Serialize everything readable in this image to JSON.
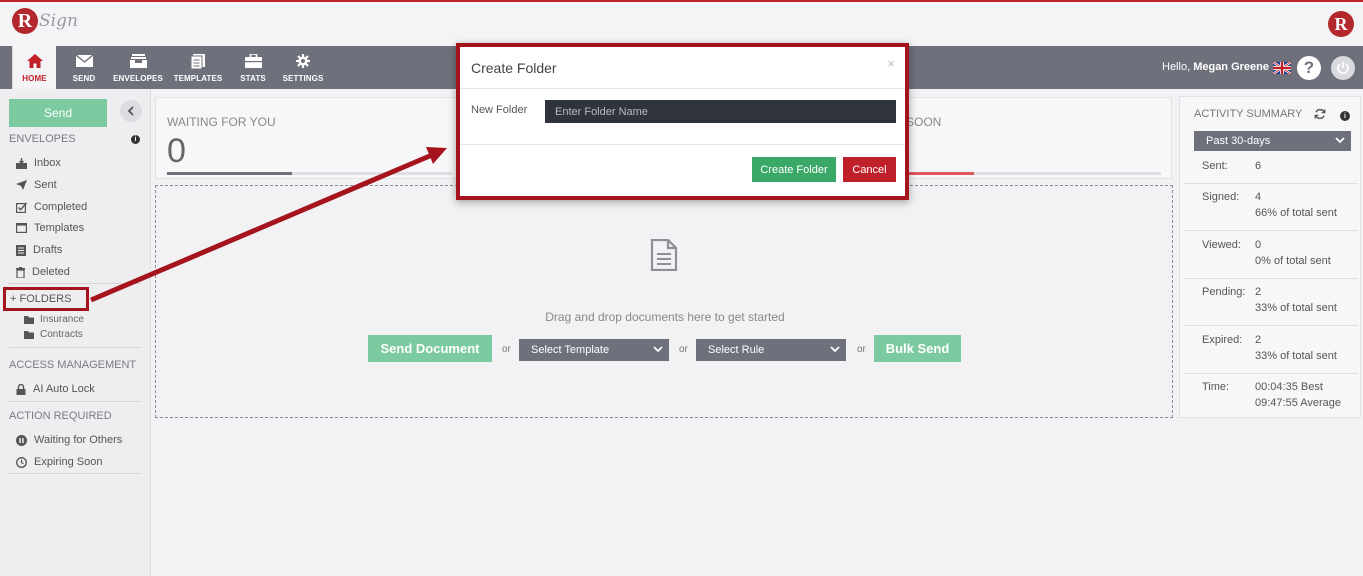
{
  "brand": {
    "logo_text": "Sign",
    "badge_letter": "R"
  },
  "nav": {
    "items": [
      {
        "label": "HOME",
        "icon": "home-icon"
      },
      {
        "label": "SEND",
        "icon": "envelope-icon"
      },
      {
        "label": "ENVELOPES",
        "icon": "inbox-tray-icon"
      },
      {
        "label": "TEMPLATES",
        "icon": "template-icon"
      },
      {
        "label": "STATS",
        "icon": "briefcase-icon"
      },
      {
        "label": "SETTINGS",
        "icon": "gear-icon"
      }
    ],
    "greeting_prefix": "Hello,",
    "user_name": "Megan Greene",
    "help_glyph": "?"
  },
  "sidebar": {
    "send_label": "Send",
    "envelopes_title": "ENVELOPES",
    "info_glyph": "i",
    "envelope_items": [
      "Inbox",
      "Sent",
      "Completed",
      "Templates",
      "Drafts",
      "Deleted"
    ],
    "folders_title": "+ FOLDERS",
    "folders": [
      "Insurance",
      "Contracts"
    ],
    "access_title": "ACCESS MANAGEMENT",
    "access_items": [
      "AI Auto Lock"
    ],
    "action_title": "ACTION REQUIRED",
    "action_items": [
      "Waiting for Others",
      "Expiring Soon"
    ]
  },
  "summary": {
    "waiting_label": "WAITING FOR YOU",
    "waiting_value": "0",
    "expiring_label_partial": "SOON",
    "accent_gray": "#6e717c",
    "accent_red": "#e0575d"
  },
  "dropzone": {
    "drag_text": "Drag and drop documents here to get started",
    "send_document": "Send Document",
    "or": "or",
    "select_template": "Select Template",
    "select_rule": "Select Rule",
    "bulk_send": "Bulk Send"
  },
  "activity": {
    "title": "ACTIVITY SUMMARY",
    "period": "Past 30-days",
    "rows": [
      {
        "label": "Sent:",
        "value": "6",
        "sub": ""
      },
      {
        "label": "Signed:",
        "value": "4",
        "sub": "66% of total sent"
      },
      {
        "label": "Viewed:",
        "value": "0",
        "sub": "0% of total sent"
      },
      {
        "label": "Pending:",
        "value": "2",
        "sub": "33% of total sent"
      },
      {
        "label": "Expired:",
        "value": "2",
        "sub": "33% of total sent"
      },
      {
        "label": "Time:",
        "value": "00:04:35 Best",
        "sub": "09:47:55 Average"
      }
    ]
  },
  "modal": {
    "title": "Create Folder",
    "close_glyph": "×",
    "field_label": "New Folder",
    "field_value": "",
    "field_placeholder": "Enter Folder Name",
    "create_label": "Create Folder",
    "cancel_label": "Cancel"
  },
  "colors": {
    "brand_red": "#c0202a",
    "highlight_red": "#a5141c",
    "nav_gray": "#6e717c",
    "send_green": "#7ccaa0",
    "create_green": "#3aa867"
  }
}
